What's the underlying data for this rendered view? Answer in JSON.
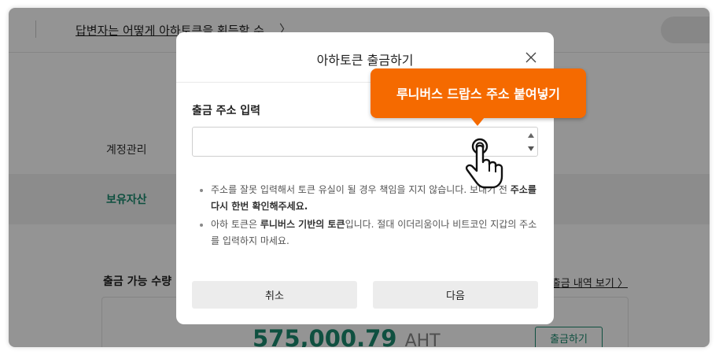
{
  "page": {
    "question_link": "답변자는 어떻게 아하토큰을 획득할 수",
    "nav_chevron": "〉",
    "sidebar": {
      "account": "계정관리",
      "assets": "보유자산"
    },
    "available_label": "출금 가능 수량",
    "history_link": "출금 내역 보기 〉",
    "balance_amount": "575,000.79",
    "balance_unit": "AHT",
    "withdraw_button": "출금하기"
  },
  "modal": {
    "title": "아하토큰 출금하기",
    "close_icon": "close-icon",
    "field_label": "출금 주소 입력",
    "address_value": "",
    "address_placeholder": "",
    "notes": [
      {
        "text_a": "주소를 잘못 입력해서 토큰 유실이 될 경우 책임을 지지 않습니다. 보내기 전 ",
        "bold_a": "주소를 다시 한번 확인해주세요."
      },
      {
        "text_a": "아하 토큰은 ",
        "bold_a": "루니버스 기반의 토큰",
        "text_b": "입니다. 절대 이더리움이나 비트코인 지갑의 주소를 입력하지 마세요."
      }
    ],
    "cancel_label": "취소",
    "next_label": "다음"
  },
  "callout": {
    "text": "루니버스 드랍스 주소 붙여넣기"
  },
  "colors": {
    "accent": "#f56a00",
    "brand_green": "#1a8a6e",
    "button_bg": "#ececec"
  }
}
